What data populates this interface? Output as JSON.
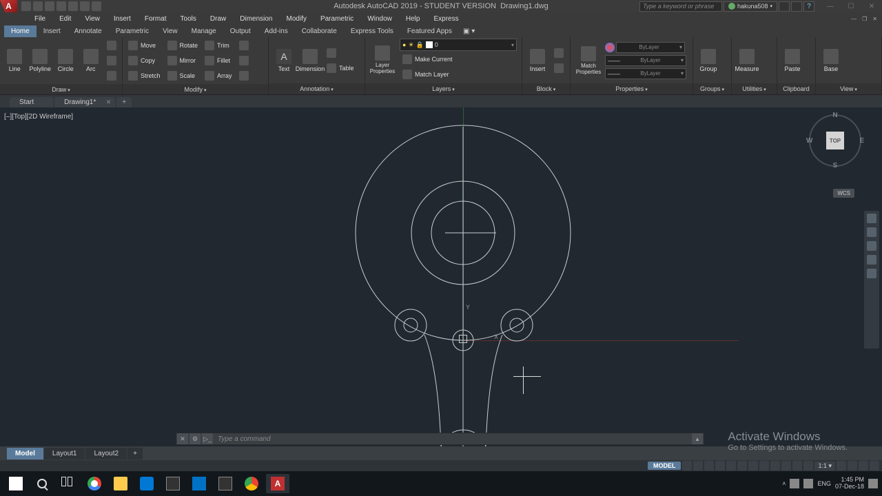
{
  "title_app": "Autodesk AutoCAD 2019 - STUDENT VERSION",
  "title_doc": "Drawing1.dwg",
  "search_placeholder": "Type a keyword or phrase",
  "user": "hakuna508",
  "menu": [
    "File",
    "Edit",
    "View",
    "Insert",
    "Format",
    "Tools",
    "Draw",
    "Dimension",
    "Modify",
    "Parametric",
    "Window",
    "Help",
    "Express"
  ],
  "ribbon_tabs": [
    "Home",
    "Insert",
    "Annotate",
    "Parametric",
    "View",
    "Manage",
    "Output",
    "Add-ins",
    "Collaborate",
    "Express Tools",
    "Featured Apps"
  ],
  "ribbon_active": "Home",
  "panels": {
    "draw": {
      "title": "Draw",
      "btns": [
        "Line",
        "Polyline",
        "Circle",
        "Arc"
      ]
    },
    "modify": {
      "title": "Modify",
      "rows": [
        [
          "Move",
          "Rotate",
          "Trim"
        ],
        [
          "Copy",
          "Mirror",
          "Fillet"
        ],
        [
          "Stretch",
          "Scale",
          "Array"
        ]
      ]
    },
    "annotation": {
      "title": "Annotation",
      "btns": [
        "Text",
        "Dimension",
        "Table"
      ]
    },
    "layers": {
      "title": "Layers",
      "prop": "Layer Properties",
      "current": "0",
      "btns": [
        "Make Current",
        "Match Layer"
      ]
    },
    "block": {
      "title": "Block",
      "btns": [
        "Insert"
      ]
    },
    "properties": {
      "title": "Properties",
      "match": "Match Properties",
      "sel": [
        "ByLayer",
        "ByLayer",
        "ByLayer"
      ]
    },
    "groups": {
      "title": "Groups",
      "btn": "Group"
    },
    "utilities": {
      "title": "Utilities",
      "btn": "Measure"
    },
    "clipboard": {
      "title": "Clipboard",
      "btn": "Paste"
    },
    "view": {
      "title": "View",
      "btn": "Base"
    }
  },
  "file_tabs": [
    {
      "label": "Start",
      "closable": false
    },
    {
      "label": "Drawing1*",
      "closable": true
    }
  ],
  "viewport_label": "[–][Top][2D Wireframe]",
  "viewcube": {
    "face": "TOP",
    "n": "N",
    "s": "S",
    "e": "E",
    "w": "W"
  },
  "wcs": "WCS",
  "ucs": {
    "x": "X",
    "y": "Y"
  },
  "command_placeholder": "Type a command",
  "activate": {
    "line1": "Activate Windows",
    "line2": "Go to Settings to activate Windows."
  },
  "layout_tabs": [
    "Model",
    "Layout1",
    "Layout2"
  ],
  "layout_active": "Model",
  "status": {
    "model": "MODEL",
    "scale": "1:1"
  },
  "tray": {
    "lang": "ENG",
    "time": "1:45 PM",
    "date": "07-Dec-18"
  }
}
